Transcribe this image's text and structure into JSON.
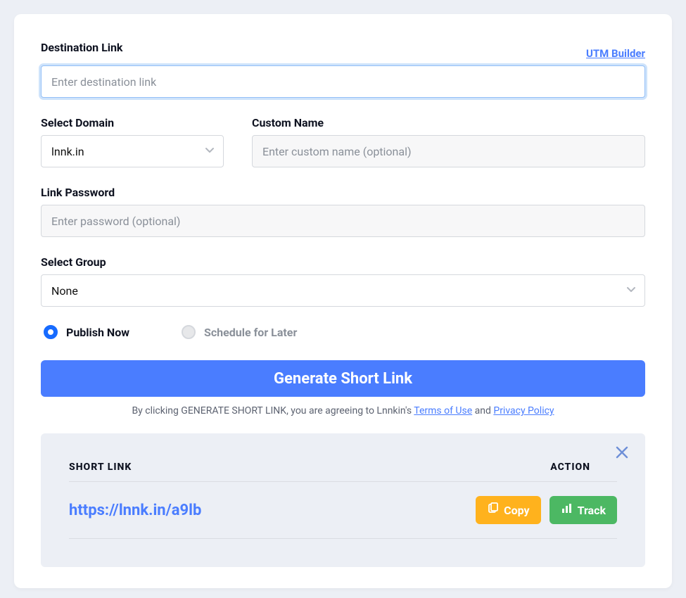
{
  "destination": {
    "label": "Destination Link",
    "placeholder": "Enter destination link",
    "utm_link": "UTM Builder"
  },
  "domain": {
    "label": "Select Domain",
    "value": "lnnk.in"
  },
  "custom_name": {
    "label": "Custom Name",
    "placeholder": "Enter custom name (optional)"
  },
  "password": {
    "label": "Link Password",
    "placeholder": "Enter password (optional)"
  },
  "group": {
    "label": "Select Group",
    "value": "None"
  },
  "publish": {
    "now": "Publish Now",
    "later": "Schedule for Later"
  },
  "generate_btn": "Generate Short Link",
  "disclaimer": {
    "pre": "By clicking GENERATE SHORT LINK, you are agreeing to Lnnkin's ",
    "terms": "Terms of Use",
    "and": " and ",
    "privacy": "Privacy Policy"
  },
  "result": {
    "header_link": "SHORT LINK",
    "header_action": "ACTION",
    "short_link": "https://lnnk.in/a9lb",
    "copy": "Copy",
    "track": "Track"
  }
}
